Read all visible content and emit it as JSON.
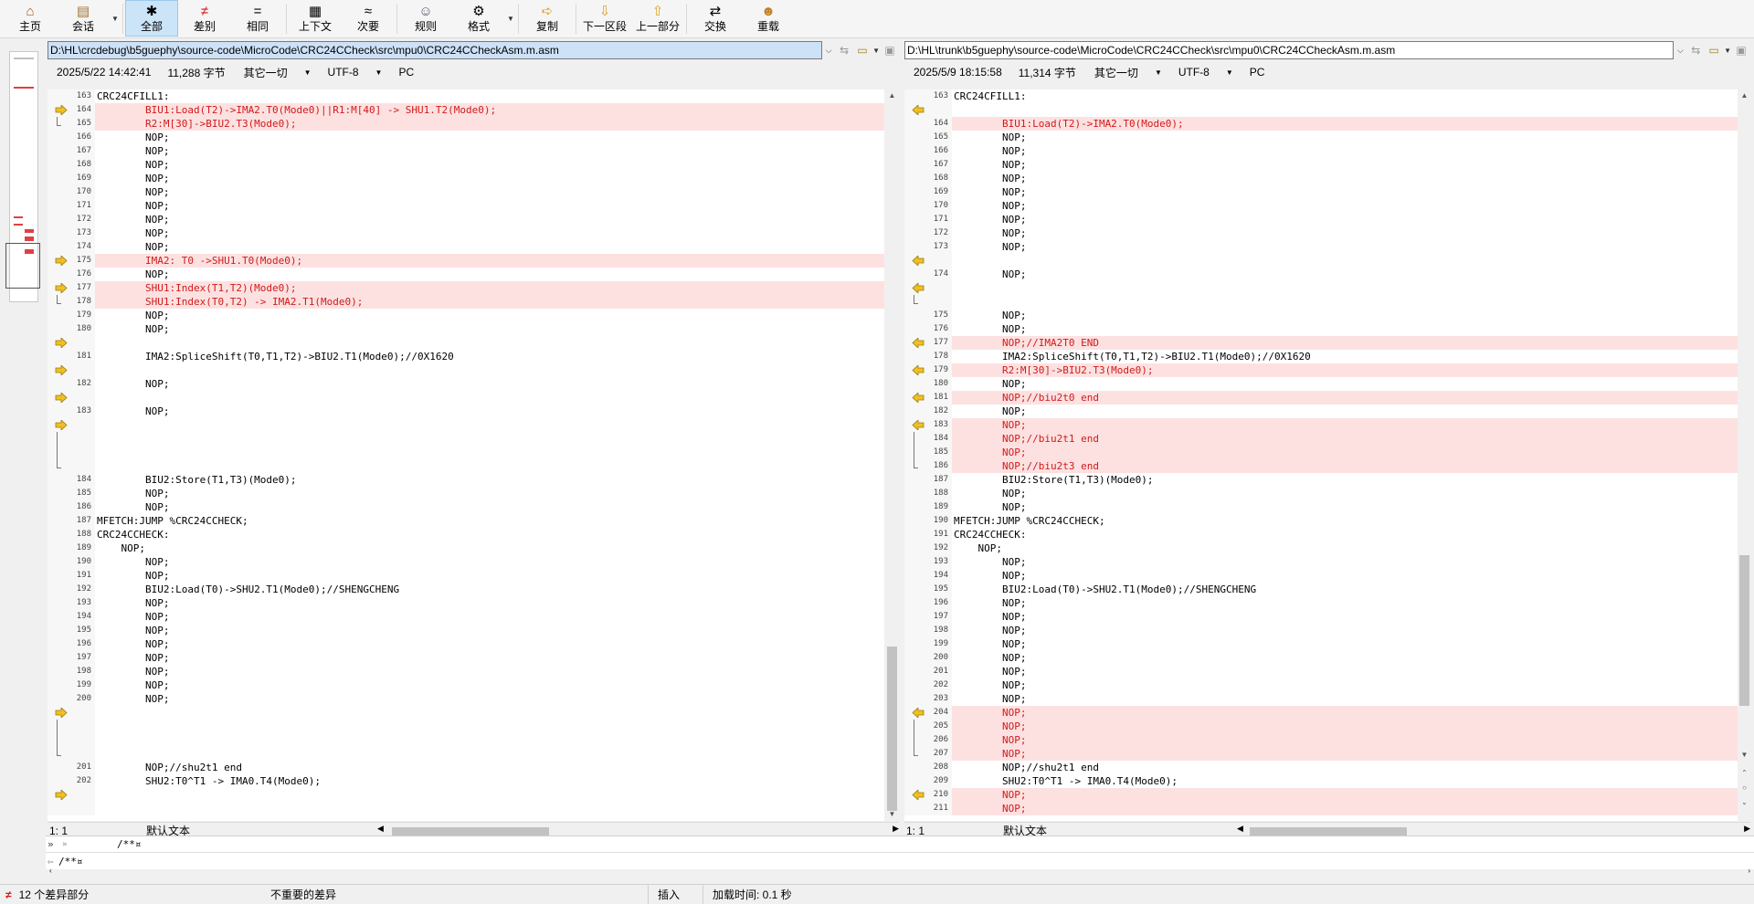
{
  "toolbar": {
    "buttons": [
      {
        "label": "主页",
        "icon": "home-icon"
      },
      {
        "label": "会话",
        "icon": "briefcase-icon"
      },
      {
        "label": "全部",
        "icon": "asterisk-icon"
      },
      {
        "label": "差别",
        "icon": "not-equal-icon"
      },
      {
        "label": "相同",
        "icon": "equal-icon"
      },
      {
        "label": "上下文",
        "icon": "context-icon"
      },
      {
        "label": "次要",
        "icon": "approx-icon"
      },
      {
        "label": "规则",
        "icon": "referee-icon"
      },
      {
        "label": "格式",
        "icon": "gear-icon"
      },
      {
        "label": "复制",
        "icon": "arrow-right-icon"
      },
      {
        "label": "下一区段",
        "icon": "arrow-down-icon"
      },
      {
        "label": "上一部分",
        "icon": "arrow-up-icon"
      },
      {
        "label": "交换",
        "icon": "swap-icon"
      },
      {
        "label": "重载",
        "icon": "reload-icon"
      }
    ],
    "active_index": 2,
    "colors": {
      "diff_red": "#d01a1a",
      "diff_bg": "#fde1e1",
      "active_bg": "#cce4f7",
      "arrow_yellow": "#f0c020"
    }
  },
  "left": {
    "path": "D:\\HL\\crcdebug\\b5guephy\\source-code\\MicroCode\\CRC24CCheck\\src\\mpu0\\CRC24CCheckAsm.m.asm",
    "date": "2025/5/22 14:42:41",
    "size": "11,288 字节",
    "compare": "其它一切",
    "encoding": "UTF-8",
    "lineend": "PC",
    "lines": [
      {
        "n": "163",
        "t": "CRC24CFILL1:",
        "k": "n"
      },
      {
        "n": "164",
        "t": "        BIU1:Load(T2)->IMA2.T0(Mode0)||R1:M[40] -> SHU1.T2(Mode0);",
        "k": "d",
        "a": 1
      },
      {
        "n": "165",
        "t": "        R2:M[30]->BIU2.T3(Mode0);",
        "k": "d",
        "b": "end"
      },
      {
        "n": "166",
        "t": "        NOP;",
        "k": "n"
      },
      {
        "n": "167",
        "t": "        NOP;",
        "k": "n"
      },
      {
        "n": "168",
        "t": "        NOP;",
        "k": "n"
      },
      {
        "n": "169",
        "t": "        NOP;",
        "k": "n"
      },
      {
        "n": "170",
        "t": "        NOP;",
        "k": "n"
      },
      {
        "n": "171",
        "t": "        NOP;",
        "k": "n"
      },
      {
        "n": "172",
        "t": "        NOP;",
        "k": "n"
      },
      {
        "n": "173",
        "t": "        NOP;",
        "k": "n"
      },
      {
        "n": "174",
        "t": "        NOP;",
        "k": "n"
      },
      {
        "n": "175",
        "t": "        IMA2: T0 ->SHU1.T0(Mode0);",
        "k": "d",
        "a": 1
      },
      {
        "n": "176",
        "t": "        NOP;",
        "k": "n"
      },
      {
        "n": "177",
        "t": "        SHU1:Index(T1,T2)(Mode0);",
        "k": "d",
        "a": 1
      },
      {
        "n": "178",
        "t": "        SHU1:Index(T0,T2) -> IMA2.T1(Mode0);",
        "k": "d",
        "b": "end"
      },
      {
        "n": "179",
        "t": "        NOP;",
        "k": "n"
      },
      {
        "n": "180",
        "t": "        NOP;",
        "k": "n"
      },
      {
        "n": "",
        "t": "",
        "k": "g",
        "a": 1
      },
      {
        "n": "181",
        "t": "        IMA2:SpliceShift(T0,T1,T2)->BIU2.T1(Mode0);//0X1620",
        "k": "n"
      },
      {
        "n": "",
        "t": "",
        "k": "g",
        "a": 1
      },
      {
        "n": "182",
        "t": "        NOP;",
        "k": "n"
      },
      {
        "n": "",
        "t": "",
        "k": "g",
        "a": 1
      },
      {
        "n": "183",
        "t": "        NOP;",
        "k": "n"
      },
      {
        "n": "",
        "t": "",
        "k": "g",
        "a": 1
      },
      {
        "n": "",
        "t": "",
        "k": "g",
        "b": "mid"
      },
      {
        "n": "",
        "t": "",
        "k": "g",
        "b": "mid"
      },
      {
        "n": "",
        "t": "",
        "k": "g",
        "b": "end"
      },
      {
        "n": "184",
        "t": "        BIU2:Store(T1,T3)(Mode0);",
        "k": "n"
      },
      {
        "n": "185",
        "t": "        NOP;",
        "k": "n"
      },
      {
        "n": "186",
        "t": "        NOP;",
        "k": "n"
      },
      {
        "n": "187",
        "t": "MFETCH:JUMP %CRC24CCHECK;",
        "k": "n"
      },
      {
        "n": "188",
        "t": "CRC24CCHECK:",
        "k": "n"
      },
      {
        "n": "189",
        "t": "    NOP;",
        "k": "n"
      },
      {
        "n": "190",
        "t": "        NOP;",
        "k": "n"
      },
      {
        "n": "191",
        "t": "        NOP;",
        "k": "n"
      },
      {
        "n": "192",
        "t": "        BIU2:Load(T0)->SHU2.T1(Mode0);//SHENGCHENG",
        "k": "n"
      },
      {
        "n": "193",
        "t": "        NOP;",
        "k": "n"
      },
      {
        "n": "194",
        "t": "        NOP;",
        "k": "n"
      },
      {
        "n": "195",
        "t": "        NOP;",
        "k": "n"
      },
      {
        "n": "196",
        "t": "        NOP;",
        "k": "n"
      },
      {
        "n": "197",
        "t": "        NOP;",
        "k": "n"
      },
      {
        "n": "198",
        "t": "        NOP;",
        "k": "n"
      },
      {
        "n": "199",
        "t": "        NOP;",
        "k": "n"
      },
      {
        "n": "200",
        "t": "        NOP;",
        "k": "n"
      },
      {
        "n": "",
        "t": "",
        "k": "g",
        "a": 1
      },
      {
        "n": "",
        "t": "",
        "k": "g",
        "b": "mid"
      },
      {
        "n": "",
        "t": "",
        "k": "g",
        "b": "mid"
      },
      {
        "n": "",
        "t": "",
        "k": "g",
        "b": "end"
      },
      {
        "n": "201",
        "t": "        NOP;//shu2t1 end",
        "k": "n"
      },
      {
        "n": "202",
        "t": "        SHU2:T0^T1 -> IMA0.T4(Mode0);",
        "k": "n"
      },
      {
        "n": "",
        "t": "",
        "k": "g",
        "a": 1
      },
      {
        "n": "",
        "t": "",
        "k": "g"
      }
    ],
    "pos": "1: 1",
    "syntax": "默认文本"
  },
  "right": {
    "path": "D:\\HL\\trunk\\b5guephy\\source-code\\MicroCode\\CRC24CCheck\\src\\mpu0\\CRC24CCheckAsm.m.asm",
    "date": "2025/5/9 18:15:58",
    "size": "11,314 字节",
    "compare": "其它一切",
    "encoding": "UTF-8",
    "lineend": "PC",
    "lines": [
      {
        "n": "163",
        "t": "CRC24CFILL1:",
        "k": "n"
      },
      {
        "n": "",
        "t": "",
        "k": "g",
        "a": 1
      },
      {
        "n": "164",
        "t": "        BIU1:Load(T2)->IMA2.T0(Mode0);",
        "k": "d"
      },
      {
        "n": "165",
        "t": "        NOP;",
        "k": "n"
      },
      {
        "n": "166",
        "t": "        NOP;",
        "k": "n"
      },
      {
        "n": "167",
        "t": "        NOP;",
        "k": "n"
      },
      {
        "n": "168",
        "t": "        NOP;",
        "k": "n"
      },
      {
        "n": "169",
        "t": "        NOP;",
        "k": "n"
      },
      {
        "n": "170",
        "t": "        NOP;",
        "k": "n"
      },
      {
        "n": "171",
        "t": "        NOP;",
        "k": "n"
      },
      {
        "n": "172",
        "t": "        NOP;",
        "k": "n"
      },
      {
        "n": "173",
        "t": "        NOP;",
        "k": "n"
      },
      {
        "n": "",
        "t": "",
        "k": "g",
        "a": 1
      },
      {
        "n": "174",
        "t": "        NOP;",
        "k": "n"
      },
      {
        "n": "",
        "t": "",
        "k": "g",
        "a": 1
      },
      {
        "n": "",
        "t": "",
        "k": "g",
        "b": "end"
      },
      {
        "n": "175",
        "t": "        NOP;",
        "k": "n"
      },
      {
        "n": "176",
        "t": "        NOP;",
        "k": "n"
      },
      {
        "n": "177",
        "t": "        NOP;//IMA2T0 END",
        "k": "d",
        "a": 1
      },
      {
        "n": "178",
        "t": "        IMA2:SpliceShift(T0,T1,T2)->BIU2.T1(Mode0);//0X1620",
        "k": "n"
      },
      {
        "n": "179",
        "t": "        R2:M[30]->BIU2.T3(Mode0);",
        "k": "d",
        "a": 1
      },
      {
        "n": "180",
        "t": "        NOP;",
        "k": "n"
      },
      {
        "n": "181",
        "t": "        NOP;//biu2t0 end",
        "k": "d",
        "a": 1
      },
      {
        "n": "182",
        "t": "        NOP;",
        "k": "n"
      },
      {
        "n": "183",
        "t": "        NOP;",
        "k": "d",
        "a": 1
      },
      {
        "n": "184",
        "t": "        NOP;//biu2t1 end",
        "k": "d",
        "b": "mid"
      },
      {
        "n": "185",
        "t": "        NOP;",
        "k": "d",
        "b": "mid"
      },
      {
        "n": "186",
        "t": "        NOP;//biu2t3 end",
        "k": "d",
        "b": "end"
      },
      {
        "n": "187",
        "t": "        BIU2:Store(T1,T3)(Mode0);",
        "k": "n"
      },
      {
        "n": "188",
        "t": "        NOP;",
        "k": "n"
      },
      {
        "n": "189",
        "t": "        NOP;",
        "k": "n"
      },
      {
        "n": "190",
        "t": "MFETCH:JUMP %CRC24CCHECK;",
        "k": "n"
      },
      {
        "n": "191",
        "t": "CRC24CCHECK:",
        "k": "n"
      },
      {
        "n": "192",
        "t": "    NOP;",
        "k": "n"
      },
      {
        "n": "193",
        "t": "        NOP;",
        "k": "n"
      },
      {
        "n": "194",
        "t": "        NOP;",
        "k": "n"
      },
      {
        "n": "195",
        "t": "        BIU2:Load(T0)->SHU2.T1(Mode0);//SHENGCHENG",
        "k": "n"
      },
      {
        "n": "196",
        "t": "        NOP;",
        "k": "n"
      },
      {
        "n": "197",
        "t": "        NOP;",
        "k": "n"
      },
      {
        "n": "198",
        "t": "        NOP;",
        "k": "n"
      },
      {
        "n": "199",
        "t": "        NOP;",
        "k": "n"
      },
      {
        "n": "200",
        "t": "        NOP;",
        "k": "n"
      },
      {
        "n": "201",
        "t": "        NOP;",
        "k": "n"
      },
      {
        "n": "202",
        "t": "        NOP;",
        "k": "n"
      },
      {
        "n": "203",
        "t": "        NOP;",
        "k": "n"
      },
      {
        "n": "204",
        "t": "        NOP;",
        "k": "d",
        "a": 1
      },
      {
        "n": "205",
        "t": "        NOP;",
        "k": "d",
        "b": "mid"
      },
      {
        "n": "206",
        "t": "        NOP;",
        "k": "d",
        "b": "mid"
      },
      {
        "n": "207",
        "t": "        NOP;",
        "k": "d",
        "b": "end"
      },
      {
        "n": "208",
        "t": "        NOP;//shu2t1 end",
        "k": "n"
      },
      {
        "n": "209",
        "t": "        SHU2:T0^T1 -> IMA0.T4(Mode0);",
        "k": "n"
      },
      {
        "n": "210",
        "t": "        NOP;",
        "k": "d",
        "a": 1
      },
      {
        "n": "211",
        "t": "        NOP;",
        "k": "d"
      }
    ],
    "pos": "1: 1",
    "syntax": "默认文本"
  },
  "bottom": {
    "line1_marker": "»",
    "line1_text": "/**¤",
    "line2_text": "/**¤"
  },
  "status": {
    "diff_count": "12 个差异部分",
    "unimportant": "不重要的差异",
    "mode": "插入",
    "load_time": "加载时间:  0.1 秒"
  }
}
